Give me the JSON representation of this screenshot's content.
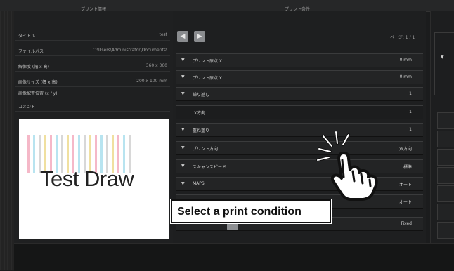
{
  "left_panel": {
    "title": "プリント情報",
    "rows": [
      {
        "key": "タイトル",
        "value": "test"
      },
      {
        "key": "ファイルパス",
        "value": "C:\\Users\\Administrator\\Documents\\"
      },
      {
        "key": "解像度 (幅 x 高)",
        "value": "360 x 360"
      },
      {
        "key": "画像サイズ (幅 x 高)",
        "value": "200 x 100 mm"
      },
      {
        "key": "画像配置位置 (x / y)",
        "value": ""
      },
      {
        "key": "コメント",
        "value": ""
      }
    ],
    "preview_text": "Test Draw"
  },
  "mid_panel": {
    "title": "プリント条件",
    "prev_icon": "chevron-left-icon",
    "next_icon": "chevron-right-icon",
    "page_indicator": "ページ: 1 / 1",
    "conditions": [
      {
        "label": "プリント原点 X",
        "value": "0 mm"
      },
      {
        "label": "プリント原点 Y",
        "value": "0 mm"
      },
      {
        "label": "繰り返し",
        "value": "1"
      },
      {
        "label": "X方向",
        "value": "1"
      },
      {
        "label": "重ね塗り",
        "value": "1"
      },
      {
        "label": "プリント方向",
        "value": "双方向"
      },
      {
        "label": "スキャンスピード",
        "value": "標準"
      },
      {
        "label": "MAPS",
        "value": "オート"
      },
      {
        "label": "",
        "value": "オート"
      },
      {
        "label": "",
        "value": "Fixed"
      }
    ]
  },
  "tooltip": "Select a print condition",
  "colors": {
    "accent_stripes": [
      "#f5b8c8",
      "#b8e4f0",
      "#f0e0a0",
      "#c8c8c8"
    ]
  }
}
